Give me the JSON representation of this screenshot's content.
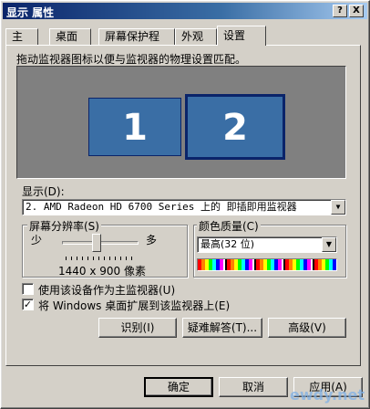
{
  "window": {
    "title": "显示 属性",
    "help_btn": "?",
    "close_btn": "X"
  },
  "tabs": [
    {
      "label": "主题"
    },
    {
      "label": "桌面"
    },
    {
      "label": "屏幕保护程序"
    },
    {
      "label": "外观"
    },
    {
      "label": "设置"
    }
  ],
  "settings": {
    "hint": "拖动监视器图标以便与监视器的物理设置匹配。",
    "monitors": [
      {
        "label": "1"
      },
      {
        "label": "2"
      }
    ],
    "display_label": "显示(D):",
    "display_value": "2. AMD Radeon HD 6700 Series  上的 即插即用监视器",
    "resolution": {
      "group_label": "屏幕分辨率(S)",
      "less": "少",
      "more": "多",
      "value_text": "1440 x 900 像素",
      "slider_level": 0.45
    },
    "color": {
      "group_label": "颜色质量(C)",
      "value": "最高(32 位)"
    },
    "primary_checkbox": {
      "label": "使用该设备作为主监视器(U)",
      "checked": false
    },
    "extend_checkbox": {
      "label": "将 Windows 桌面扩展到该监视器上(E)",
      "checked": true,
      "mark": "✓"
    },
    "buttons": {
      "identify": "识别(I)",
      "troubleshoot": "疑难解答(T)...",
      "advanced": "高级(V)"
    }
  },
  "footer": {
    "ok": "确定",
    "cancel": "取消",
    "apply": "应用(A)"
  },
  "watermark": "ewdy.net"
}
